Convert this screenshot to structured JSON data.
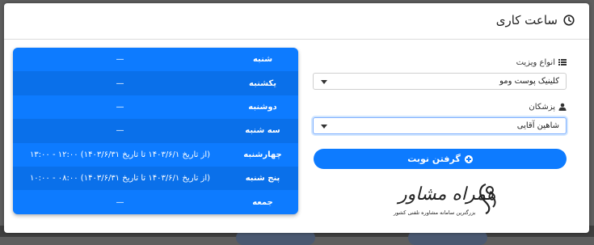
{
  "modal": {
    "title": "ساعت کاری",
    "icon": "clock-icon"
  },
  "schedule": [
    {
      "day": "شنبه",
      "hours": "—"
    },
    {
      "day": "یکشنبه",
      "hours": "—"
    },
    {
      "day": "دوشنبه",
      "hours": "—"
    },
    {
      "day": "سه شنبه",
      "hours": "—"
    },
    {
      "day": "چهارشنبه",
      "hours": "(از تاریخ ۱۴۰۳/۶/۱ تا تاریخ ۱۴۰۳/۶/۳۱) ۱۲:۰۰ - ۱۳:۰۰"
    },
    {
      "day": "پنج شنبه",
      "hours": "(از تاریخ ۱۴۰۳/۶/۱ تا تاریخ ۱۴۰۳/۶/۳۱) ۰۸:۰۰ - ۱۰:۰۰"
    },
    {
      "day": "جمعه",
      "hours": "—"
    }
  ],
  "form": {
    "visit_type_label": "انواع ویزیت",
    "visit_type_value": "کلینیک پوست ومو",
    "doctors_label": "پزشکان",
    "doctor_value": "شاهین آقایی",
    "book_button": "گرفتن نوبت"
  },
  "logo": {
    "name": "همراه مشاور",
    "tagline": "بزرگترین سامانه مشاوره تلفنی کشور"
  },
  "colors": {
    "primary": "#0d7bff",
    "backdrop": "#5e5e5e"
  }
}
